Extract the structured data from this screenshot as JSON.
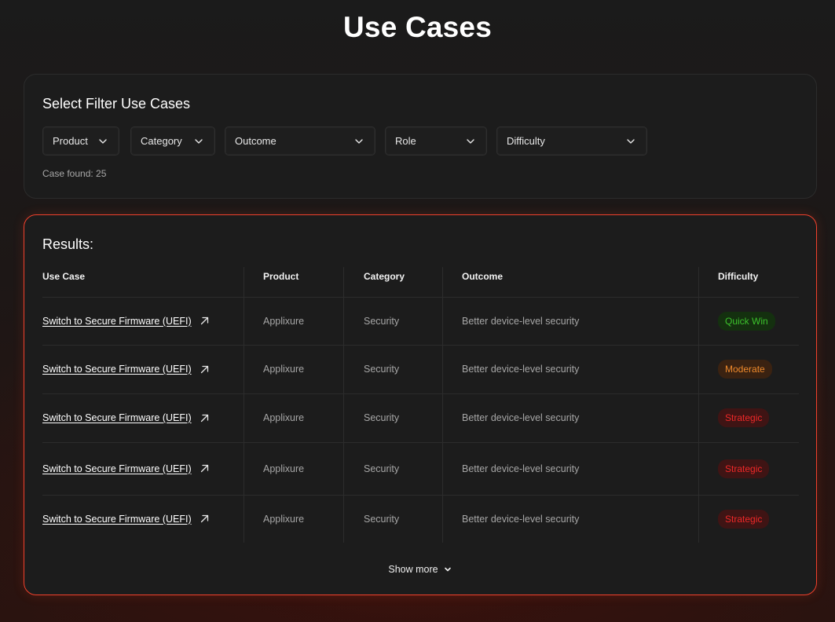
{
  "page": {
    "title": "Use Cases"
  },
  "filters": {
    "title": "Select Filter Use Cases",
    "dropdowns": [
      {
        "label": "Product"
      },
      {
        "label": "Category"
      },
      {
        "label": "Outcome"
      },
      {
        "label": "Role"
      },
      {
        "label": "Difficulty"
      }
    ],
    "case_found": "Case found: 25"
  },
  "results": {
    "title": "Results:",
    "columns": [
      "Use Case",
      "Product",
      "Category",
      "Outcome",
      "Difficulty"
    ],
    "rows": [
      {
        "use_case": "Switch to Secure Firmware (UEFI)",
        "product": "Applixure",
        "category": "Security",
        "outcome": "Better device-level security",
        "difficulty": "Quick Win"
      },
      {
        "use_case": "Switch to Secure Firmware (UEFI)",
        "product": "Applixure",
        "category": "Security",
        "outcome": "Better device-level security",
        "difficulty": "Moderate"
      },
      {
        "use_case": "Switch to Secure Firmware (UEFI)",
        "product": "Applixure",
        "category": "Security",
        "outcome": "Better device-level security",
        "difficulty": "Strategic"
      },
      {
        "use_case": "Switch to Secure Firmware (UEFI)",
        "product": "Applixure",
        "category": "Security",
        "outcome": "Better device-level security",
        "difficulty": "Strategic"
      },
      {
        "use_case": "Switch to Secure Firmware (UEFI)",
        "product": "Applixure",
        "category": "Security",
        "outcome": "Better device-level security",
        "difficulty": "Strategic"
      }
    ],
    "show_more": "Show more"
  },
  "colors": {
    "accent_border": "#f0402c",
    "quick_win": "#3cc12c",
    "moderate": "#ef8a2c",
    "strategic": "#f02828"
  },
  "icons": {
    "dropdown": "chevron-down-icon",
    "external": "arrow-up-right-icon",
    "show_more": "chevron-down-icon"
  }
}
